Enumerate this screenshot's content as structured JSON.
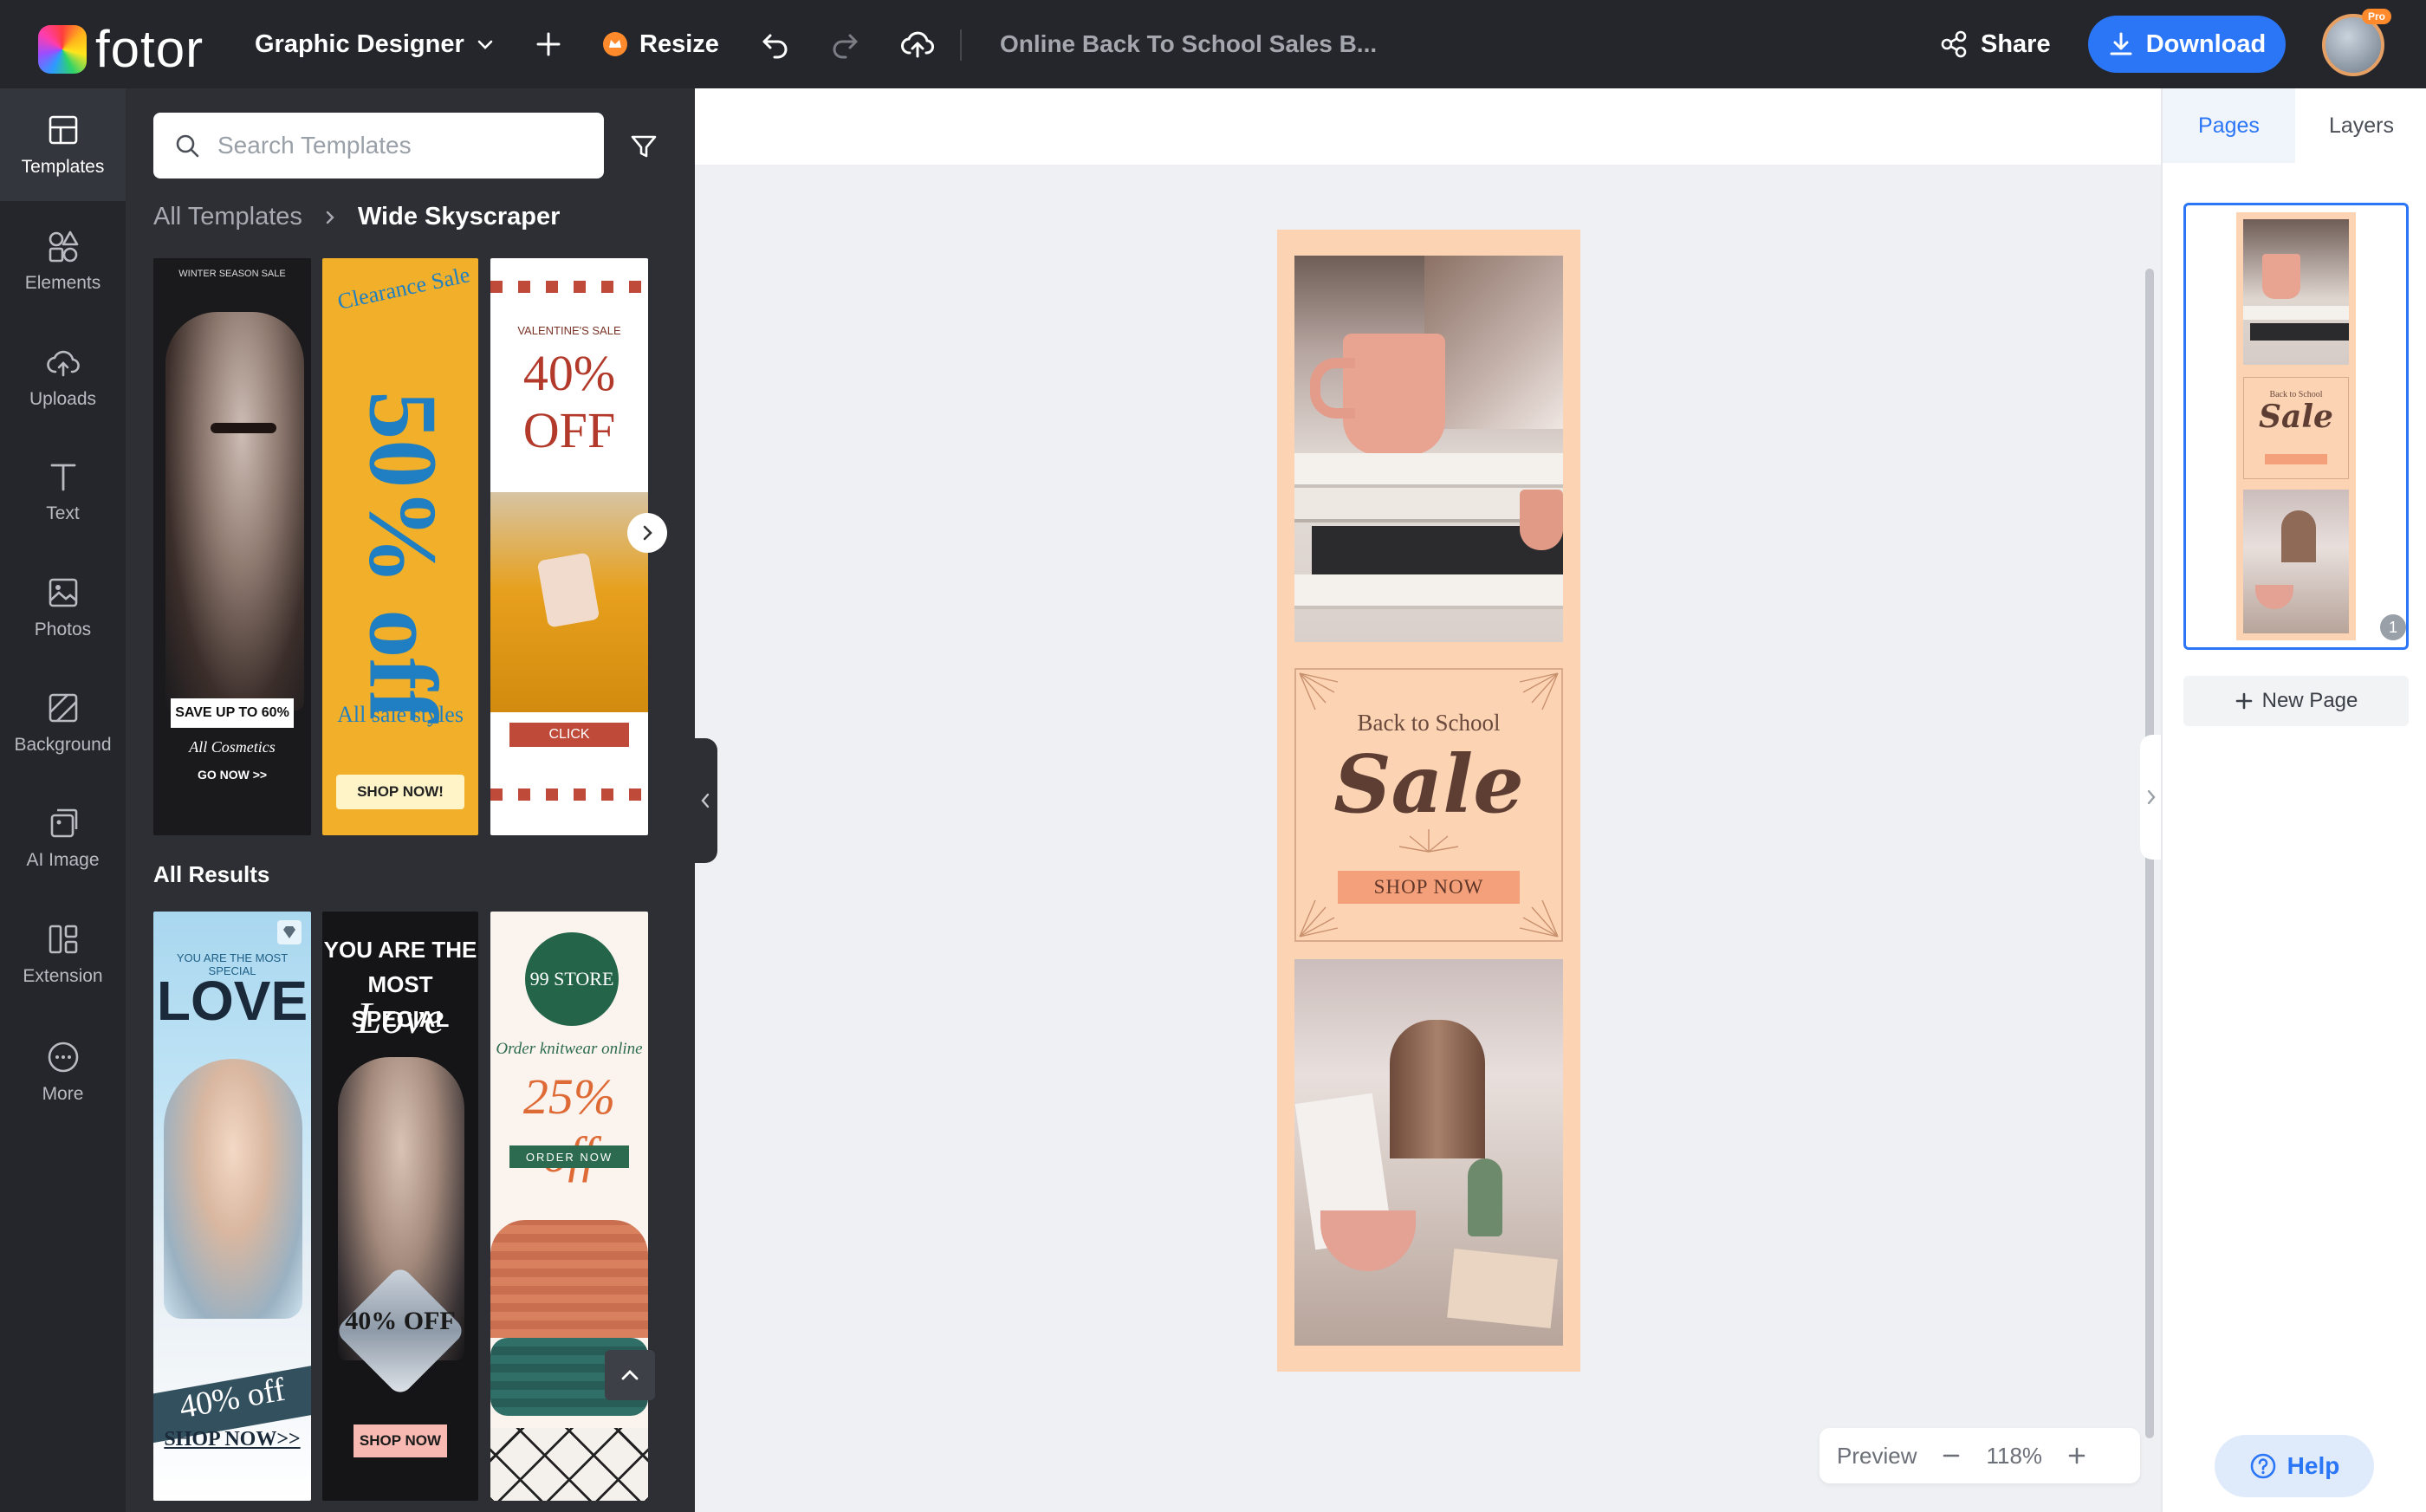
{
  "app": {
    "name": "fotor"
  },
  "topbar": {
    "role": "Graphic Designer",
    "resize": "Resize",
    "doc_title": "Online Back To School Sales B...",
    "share": "Share",
    "download": "Download",
    "pro_badge": "Pro"
  },
  "rail": {
    "items": [
      {
        "label": "Templates"
      },
      {
        "label": "Elements"
      },
      {
        "label": "Uploads"
      },
      {
        "label": "Text"
      },
      {
        "label": "Photos"
      },
      {
        "label": "Background"
      },
      {
        "label": "AI Image"
      },
      {
        "label": "Extension"
      },
      {
        "label": "More"
      }
    ]
  },
  "panel": {
    "search_placeholder": "Search Templates",
    "breadcrumb": [
      "All Templates",
      "Wide Skyscraper"
    ],
    "all_results": "All Results",
    "featured": [
      {
        "top": "WINTER SEASON SALE",
        "cta": "SAVE UP TO 60%",
        "sub": "All Cosmetics",
        "link": "GO NOW >>"
      },
      {
        "top": "Clearance Sale",
        "big": "50% off",
        "sub": "All sale styles",
        "cta": "SHOP NOW!"
      },
      {
        "top": "VALENTINE'S SALE",
        "big": "40% OFF",
        "cta": "CLICK"
      }
    ],
    "results": [
      {
        "top": "YOU ARE THE MOST SPECIAL",
        "big": "LOVE",
        "offer": "40% off",
        "cta": "SHOP NOW>>"
      },
      {
        "top": "YOU ARE THE MOST SPECIAL",
        "script": "Love",
        "offer": "40% OFF",
        "cta": "SHOP NOW"
      },
      {
        "badge": "99 STORE",
        "top": "Order knitwear online",
        "big": "25% off",
        "cta": "ORDER NOW"
      }
    ]
  },
  "design": {
    "small": "Back to School",
    "big": "Sale",
    "cta": "SHOP NOW"
  },
  "zoom": {
    "preview": "Preview",
    "level": "118%"
  },
  "rpanel": {
    "tabs": [
      "Pages",
      "Layers"
    ],
    "page_number": "1",
    "new_page": "New Page"
  },
  "help": "Help",
  "colors": {
    "accent": "#2a76f6",
    "topbar": "#24262b",
    "panel": "#2d2f35",
    "design_bg": "#fcd4b4"
  }
}
